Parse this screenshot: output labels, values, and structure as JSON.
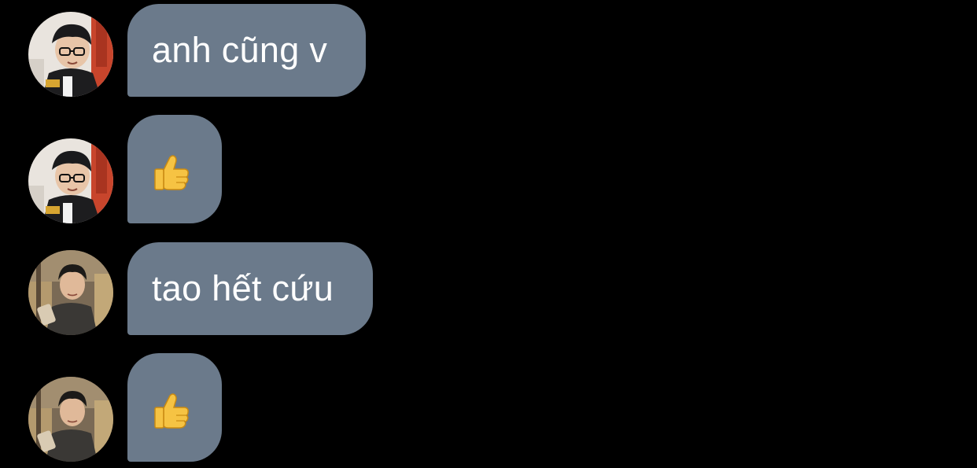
{
  "colors": {
    "background": "#000000",
    "bubble": "#6b7a8b",
    "text": "#ffffff"
  },
  "messages": [
    {
      "sender": "user-a",
      "type": "text",
      "text": "anh cũng v"
    },
    {
      "sender": "user-a",
      "type": "emoji",
      "icon": "thumbs-up-icon"
    },
    {
      "sender": "user-b",
      "type": "text",
      "text": "tao hết cứu"
    },
    {
      "sender": "user-b",
      "type": "emoji",
      "icon": "thumbs-up-icon"
    }
  ]
}
